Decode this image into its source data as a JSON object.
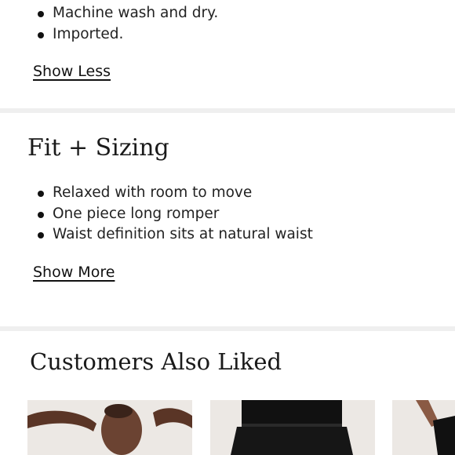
{
  "details": {
    "bullets": [
      "Machine wash and dry.",
      "Imported."
    ],
    "toggle_label": "Show Less"
  },
  "fit_sizing": {
    "title": "Fit + Sizing",
    "bullets": [
      "Relaxed with room to move",
      "One piece long romper",
      "Waist definition sits at natural waist"
    ],
    "toggle_label": "Show More"
  },
  "recommendations": {
    "title": "Customers Also Liked",
    "products": [
      {
        "image": "model-with-arms-raised"
      },
      {
        "image": "black-tank-and-pants"
      },
      {
        "image": "model-partial"
      }
    ]
  },
  "colors": {
    "divider": "#efefef",
    "photo_background": "#ece8e4",
    "garment": "#111111",
    "skin": "#6b4332"
  }
}
